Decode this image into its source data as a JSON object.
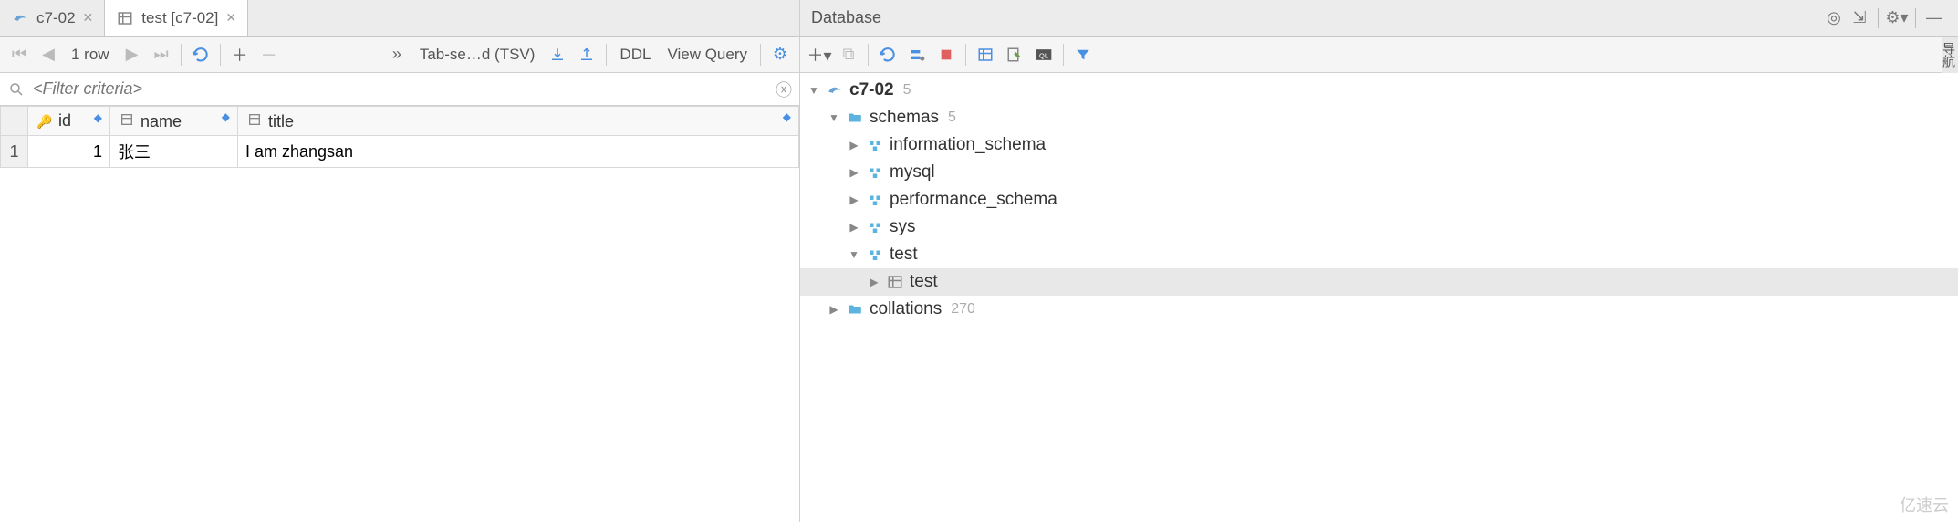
{
  "tabs": [
    {
      "label": "c7-02",
      "active": false
    },
    {
      "label": "test [c7-02]",
      "active": true
    }
  ],
  "toolbar": {
    "row_count": "1 row",
    "export_label": "Tab-se…d (TSV)",
    "ddl": "DDL",
    "view_query": "View Query"
  },
  "filter": {
    "placeholder": "<Filter criteria>"
  },
  "columns": [
    {
      "name": "id",
      "type": "key"
    },
    {
      "name": "name",
      "type": "col"
    },
    {
      "name": "title",
      "type": "col"
    }
  ],
  "rows": [
    {
      "num": "1",
      "id": "1",
      "name": "张三",
      "title": "I am zhangsan"
    }
  ],
  "db_panel": {
    "title": "Database",
    "tree": {
      "root": {
        "label": "c7-02",
        "count": "5"
      },
      "schemas": {
        "label": "schemas",
        "count": "5"
      },
      "schema_list": [
        "information_schema",
        "mysql",
        "performance_schema",
        "sys"
      ],
      "test_schema": "test",
      "test_table": "test",
      "collations": {
        "label": "collations",
        "count": "270"
      }
    }
  },
  "side_tab": "导航",
  "watermark": "亿速云"
}
